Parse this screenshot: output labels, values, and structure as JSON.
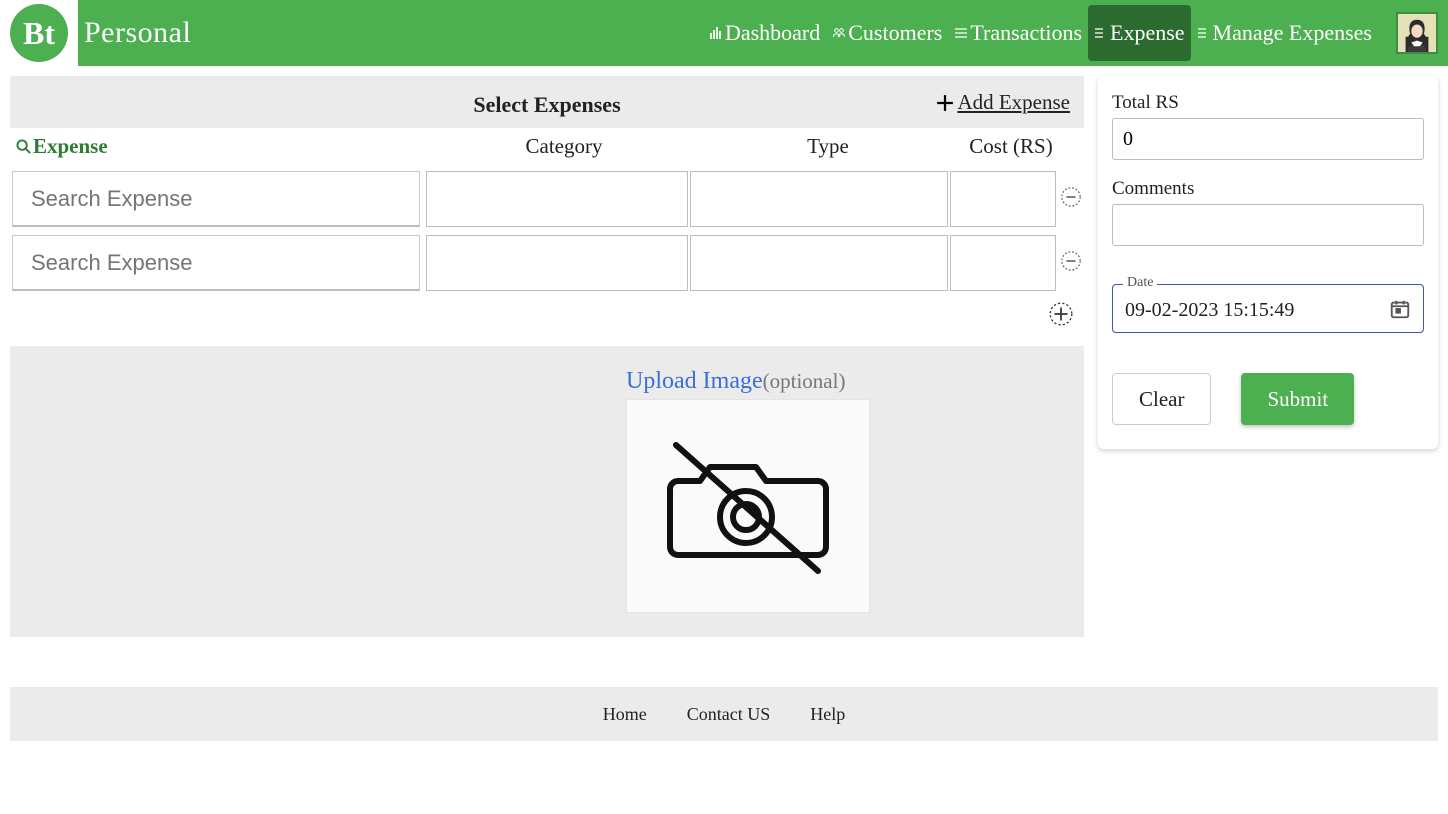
{
  "brand": {
    "logo_text": "Bt",
    "title": "Personal"
  },
  "nav": {
    "items": [
      {
        "label": "Dashboard"
      },
      {
        "label": "Customers"
      },
      {
        "label": "Transactions"
      },
      {
        "label": "Expense"
      },
      {
        "label": "Manage Expenses"
      }
    ],
    "active_index": 3
  },
  "main": {
    "title": "Select Expenses",
    "add_expense_label": "Add Expense",
    "columns": {
      "expense": "Expense",
      "category": "Category",
      "type": "Type",
      "cost": "Cost (RS)"
    },
    "rows": [
      {
        "expense_placeholder": "Search Expense",
        "category": "",
        "type": "",
        "cost": ""
      },
      {
        "expense_placeholder": "Search Expense",
        "category": "",
        "type": "",
        "cost": ""
      }
    ],
    "upload": {
      "link_text": "Upload Image",
      "optional_text": "(optional)"
    }
  },
  "side": {
    "total_label": "Total RS",
    "total_value": "0",
    "comments_label": "Comments",
    "comments_value": "",
    "date_label": "Date",
    "date_value": "09-02-2023 15:15:49",
    "clear_label": "Clear",
    "submit_label": "Submit"
  },
  "footer": {
    "home": "Home",
    "contact": "Contact US",
    "help": "Help"
  }
}
